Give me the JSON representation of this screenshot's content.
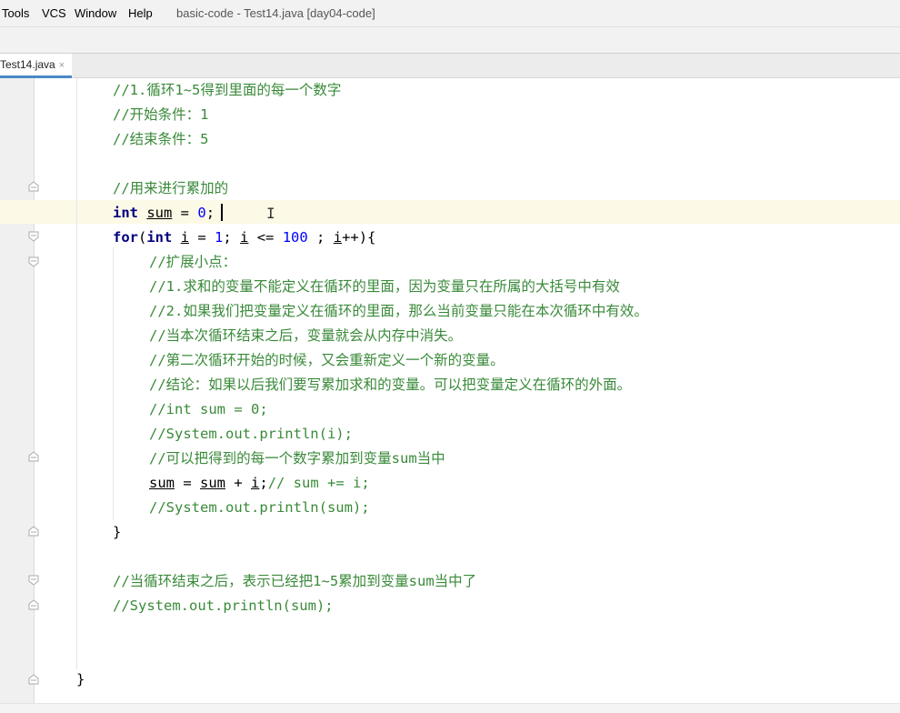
{
  "menu": {
    "items": [
      "Tools",
      "VCS",
      "Window",
      "Help"
    ],
    "window_title": "basic-code - Test14.java [day04-code]"
  },
  "tab": {
    "name": "Test14.java",
    "close_glyph": "×"
  },
  "code": {
    "c1": "//1.循环1~5得到里面的每一个数字",
    "c2": "//开始条件：1",
    "c3": "//结束条件：5",
    "c4": "//用来进行累加的",
    "l_int_kw": "int",
    "l_int_var": "sum",
    "l_int_rest1": " = ",
    "l_int_num": "0",
    "l_int_rest2": ";",
    "l_for_kw": "for",
    "l_for_p1": "(",
    "l_for_kw2": "int",
    "l_for_p2": " ",
    "l_for_i1": "i",
    "l_for_p3": " = ",
    "l_for_n1": "1",
    "l_for_p4": "; ",
    "l_for_i2": "i",
    "l_for_p5": " <= ",
    "l_for_n2": "100",
    "l_for_p6": " ; ",
    "l_for_i3": "i",
    "l_for_p7": "++){",
    "c5": "//扩展小点：",
    "c6": "//1.求和的变量不能定义在循环的里面，因为变量只在所属的大括号中有效",
    "c7": "//2.如果我们把变量定义在循环的里面，那么当前变量只能在本次循环中有效。",
    "c8": "//当本次循环结束之后，变量就会从内存中消失。",
    "c9": "//第二次循环开始的时候，又会重新定义一个新的变量。",
    "c10": "//结论：如果以后我们要写累加求和的变量。可以把变量定义在循环的外面。",
    "c11": "//int sum = 0;",
    "c12": "//System.out.println(i);",
    "c13": "//可以把得到的每一个数字累加到变量sum当中",
    "l_sum_v1": "sum",
    "l_sum_p1": " = ",
    "l_sum_v2": "sum",
    "l_sum_p2": " + ",
    "l_sum_v3": "i",
    "l_sum_p3": ";",
    "l_sum_cm": "// sum += i;",
    "c14": "//System.out.println(sum);",
    "close1": "}",
    "c15": "//当循环结束之后，表示已经把1~5累加到变量sum当中了",
    "c16": "//System.out.println(sum);",
    "close2": "}"
  },
  "colors": {
    "comment": "#3a8a3a",
    "keyword": "#000080",
    "number": "#0000ff",
    "current_line": "#fcfae6"
  },
  "icons": [
    "fold-marker-icon",
    "text-cursor-icon"
  ]
}
